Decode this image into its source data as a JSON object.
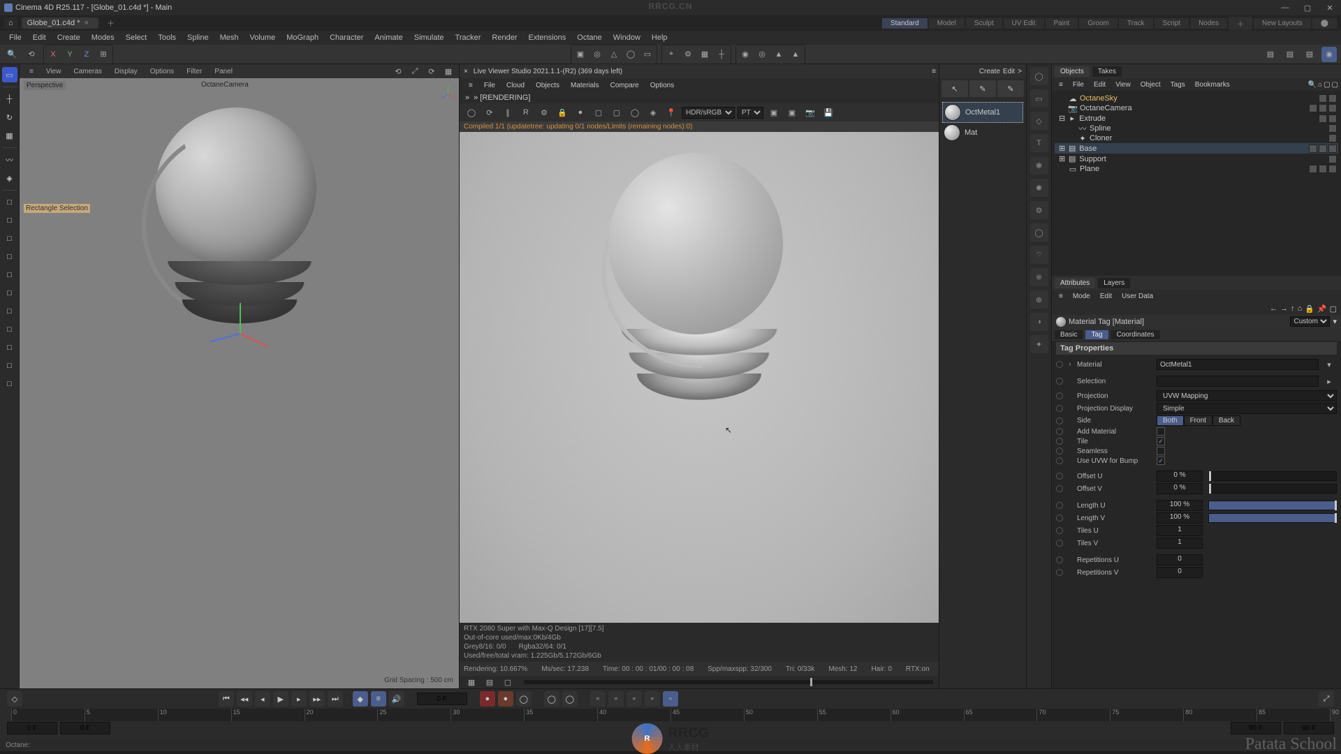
{
  "titlebar": {
    "title": "Cinema 4D R25.117 - [Globe_01.c4d *] - Main",
    "min": "—",
    "max": "▢",
    "close": "✕"
  },
  "wm_top": "RRCG.CN",
  "tabstrip": {
    "hometab": "⌂",
    "file": "Globe_01.c4d *",
    "close": "×",
    "add": "＋",
    "layouts": [
      "Standard",
      "Model",
      "Sculpt",
      "UV Edit",
      "Paint",
      "Groom",
      "Track",
      "Script",
      "Nodes"
    ],
    "layout_active": 0,
    "plus": "＋",
    "new_layouts": "New Layouts"
  },
  "menubar": [
    "File",
    "Edit",
    "Create",
    "Modes",
    "Select",
    "Tools",
    "Spline",
    "Mesh",
    "Volume",
    "MoGraph",
    "Character",
    "Animate",
    "Simulate",
    "Tracker",
    "Render",
    "Extensions",
    "Octane",
    "Window",
    "Help"
  ],
  "uppertoolbar": {
    "axes": {
      "x": "X",
      "y": "Y",
      "z": "Z"
    },
    "right_icons": [
      "☐",
      "☐",
      "☐",
      "○"
    ]
  },
  "leftcol_tools": [
    "▭",
    "┼",
    "↻",
    "▦",
    "〰",
    "◈",
    "□",
    "□",
    "□",
    "□",
    "□",
    "□",
    "□",
    "□",
    "□",
    "□",
    "□"
  ],
  "viewport": {
    "menus": [
      "≡",
      "View",
      "Cameras",
      "Display",
      "Options",
      "Filter",
      "Panel"
    ],
    "right_icons": [
      "⟲",
      "⤢",
      "⟳",
      "▦"
    ],
    "label": "Perspective",
    "camera_label": "OctaneCamera",
    "rect_tool": "Rectangle Selection",
    "grid_spacing": "Grid Spacing : 500 cm"
  },
  "liveviewer": {
    "header": "Live Viewer Studio 2021.1.1-(R2) (369 days left)",
    "menus": [
      "≡",
      "File",
      "Cloud",
      "Objects",
      "Materials",
      "Compare",
      "Options"
    ],
    "rendering_crumb": "» [RENDERING]",
    "sel1_opts": [
      "HDR/sRGB"
    ],
    "sel2_opts": [
      "PT"
    ],
    "orange": "Compiled 1/1 (updatetree: updating 0/1 nodes/Limits (remaining nodes):0)",
    "stats": {
      "gpu": "RTX 2080 Super with Max-Q Design  [17][7.5]",
      "ooc": "Out-of-core used/max:0Kb/4Gb",
      "grey": "Grey8/16: 0/0",
      "rgba": "Rgba32/64: 0/1",
      "vram": "Used/free/total vram: 1.225Gb/5.172Gb/6Gb"
    },
    "footer": {
      "rendering": "Rendering: 10.667%",
      "ms": "Ms/sec: 17.238",
      "time": "Time: 00 : 00 : 01/00 : 00 : 08",
      "spp": "Spp/maxspp: 32/300",
      "tri": "Tri: 0/33k",
      "mesh": "Mesh: 12",
      "hair": "Hair: 0",
      "rtx": "RTX:on"
    }
  },
  "create_panel": {
    "menus": [
      "Create",
      "Edit",
      ">"
    ],
    "tools": [
      "↖",
      "✎",
      "✎"
    ]
  },
  "materials": [
    {
      "name": "OctMetal1",
      "sel": true
    },
    {
      "name": "Mat",
      "sel": false
    }
  ],
  "iconcol": [
    "◯",
    "▭",
    "◇",
    "T",
    "❃",
    "✺",
    "⚙",
    "◯",
    "⌔",
    "※",
    "⊕",
    "◑",
    "✦"
  ],
  "objects_panel": {
    "tabs": [
      "Objects",
      "Takes"
    ],
    "menus": [
      "≡",
      "File",
      "Edit",
      "View",
      "Object",
      "Tags",
      "Bookmarks"
    ],
    "tree": [
      {
        "indent": 0,
        "icon": "☁",
        "name": "OctaneSky",
        "sel": false,
        "tags": 2,
        "color": "#e8c060"
      },
      {
        "indent": 0,
        "icon": "📷",
        "name": "OctaneCamera",
        "sel": false,
        "tags": 3,
        "color": "#c8c8c8"
      },
      {
        "indent": 0,
        "icon": "▸",
        "name": "Extrude",
        "sel": false,
        "tags": 2,
        "color": "#c8c8c8",
        "expander": "⊟"
      },
      {
        "indent": 1,
        "icon": "〰",
        "name": "Spline",
        "sel": false,
        "tags": 1,
        "color": "#c8c8c8"
      },
      {
        "indent": 1,
        "icon": "✦",
        "name": "Cloner",
        "sel": false,
        "tags": 1,
        "color": "#c8c8c8"
      },
      {
        "indent": 0,
        "icon": "▤",
        "name": "Base",
        "sel": true,
        "tags": 3,
        "color": "#c8c8c8",
        "expander": "⊞"
      },
      {
        "indent": 0,
        "icon": "▤",
        "name": "Support",
        "sel": false,
        "tags": 1,
        "color": "#c8c8c8",
        "expander": "⊞"
      },
      {
        "indent": 0,
        "icon": "▭",
        "name": "Plane",
        "sel": false,
        "tags": 3,
        "color": "#c8c8c8"
      }
    ]
  },
  "attributes": {
    "tabs_top": [
      "Attributes",
      "Layers"
    ],
    "menus": [
      "≡",
      "Mode",
      "Edit",
      "User Data"
    ],
    "header": "Material Tag [Material]",
    "custom": "Custom",
    "subtabs": [
      "Basic",
      "Tag",
      "Coordinates"
    ],
    "subtab_active": 1,
    "title": "Tag Properties",
    "rows": {
      "material_label": "Material",
      "material_val": "OctMetal1",
      "selection_label": "Selection",
      "selection_val": "",
      "projection_label": "Projection",
      "projection_val": "UVW Mapping",
      "projdisp_label": "Projection Display",
      "projdisp_val": "Simple",
      "side_label": "Side",
      "side_opts": [
        "Both",
        "Front",
        "Back"
      ],
      "addmat_label": "Add Material",
      "addmat_val": false,
      "tile_label": "Tile",
      "tile_val": true,
      "seamless_label": "Seamless",
      "seamless_val": false,
      "uvwbump_label": "Use UVW for Bump",
      "uvwbump_val": true,
      "offu_label": "Offset U",
      "offu_val": "0 %",
      "offv_label": "Offset V",
      "offv_val": "0 %",
      "lenu_label": "Length U",
      "lenu_val": "100 %",
      "lenv_label": "Length V",
      "lenv_val": "100 %",
      "tilesu_label": "Tiles U",
      "tilesu_val": "1",
      "tilesv_label": "Tiles V",
      "tilesv_val": "1",
      "repu_label": "Repetitions U",
      "repu_val": "0",
      "repv_label": "Repetitions V",
      "repv_val": "0"
    }
  },
  "timeline": {
    "frame_field": "0 F",
    "start": "0 F",
    "end": "90 F",
    "range_end": "90 F",
    "ticks": [
      0,
      5,
      10,
      15,
      20,
      25,
      30,
      35,
      40,
      45,
      50,
      55,
      60,
      65,
      70,
      75,
      80,
      85,
      90
    ]
  },
  "status": "Octane:",
  "wm_text": "RRCG",
  "wm_sub": "人人素材",
  "patata": "Patata School"
}
